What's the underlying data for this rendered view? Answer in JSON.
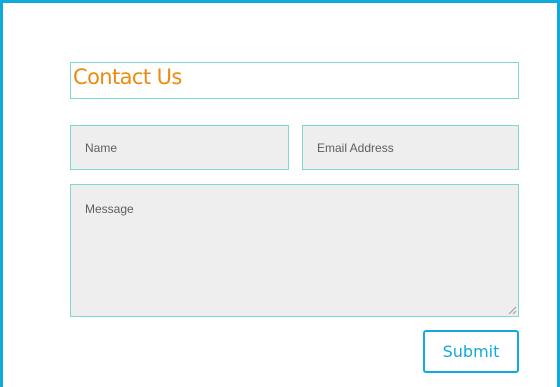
{
  "form": {
    "title": "Contact Us",
    "name_placeholder": "Name",
    "email_placeholder": "Email Address",
    "message_placeholder": "Message",
    "submit_label": "Submit"
  },
  "colors": {
    "accent": "#12a9df",
    "title": "#ee8a0f",
    "field_border": "#7fd9cf",
    "field_background": "#eeeeee"
  }
}
